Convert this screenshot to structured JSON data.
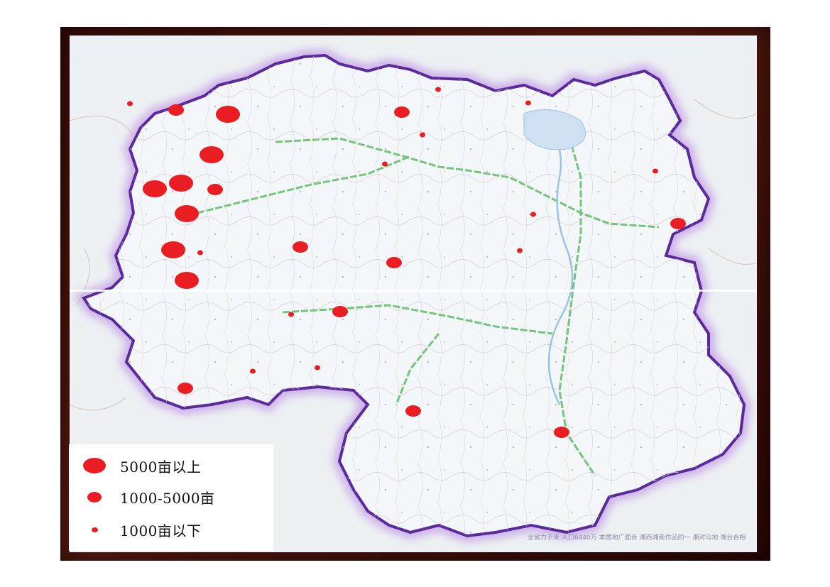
{
  "map": {
    "site_markers": [
      {
        "size": "large"
      },
      {
        "size": "medium"
      },
      {
        "size": "small"
      },
      {
        "size": "large"
      },
      {
        "size": "large"
      },
      {
        "size": "medium"
      },
      {
        "size": "large"
      },
      {
        "size": "large"
      },
      {
        "size": "small"
      },
      {
        "size": "large"
      },
      {
        "size": "large"
      },
      {
        "size": "medium"
      },
      {
        "size": "medium"
      },
      {
        "size": "small"
      },
      {
        "size": "small"
      },
      {
        "size": "small"
      },
      {
        "size": "small"
      },
      {
        "size": "small"
      },
      {
        "size": "small"
      },
      {
        "size": "small"
      },
      {
        "size": "medium"
      },
      {
        "size": "medium"
      },
      {
        "size": "small"
      },
      {
        "size": "medium"
      },
      {
        "size": "small"
      },
      {
        "size": "small"
      },
      {
        "size": "medium"
      },
      {
        "size": "medium"
      },
      {
        "size": "medium"
      }
    ],
    "note_text": "全省力于米 人口6440万 本图地广面合 湘西湘南作品的一 湘对与地 湘台合相"
  },
  "legend": {
    "items": [
      {
        "label": "5000亩以上",
        "size": "large"
      },
      {
        "label": "1000-5000亩",
        "size": "medium"
      },
      {
        "label": "1000亩以下",
        "size": "small"
      }
    ]
  },
  "colors": {
    "marker": "#ea1d22",
    "border": "#5a2a9a",
    "border_glow": "#c9a8e8",
    "province_fill": "#f3f6f8",
    "frame": "#4a1008"
  }
}
